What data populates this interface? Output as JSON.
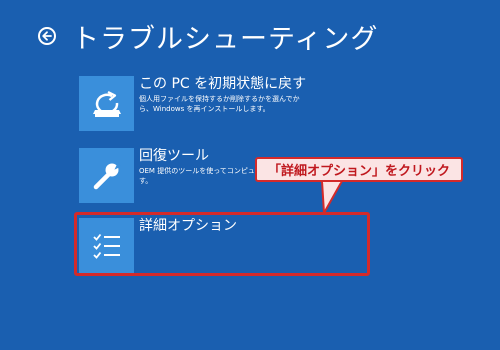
{
  "header": {
    "title": "トラブルシューティング"
  },
  "options": [
    {
      "title": "この PC を初期状態に戻す",
      "description": "個人用ファイルを保持するか削除するかを選んでから、Windows を再インストールします。",
      "icon": "reset-pc-icon"
    },
    {
      "title": "回復ツール",
      "description": "OEM 提供のツールを使ってコンピューターを修復します。",
      "icon": "wrench-icon"
    },
    {
      "title": "詳細オプション",
      "description": "",
      "icon": "checklist-icon"
    }
  ],
  "annotation": {
    "callout_text": "「詳細オプション」をクリック"
  },
  "colors": {
    "background": "#1a5fb0",
    "tile": "#3a8fdb",
    "highlight": "#d42a2a",
    "callout_bg": "#fbe4e4"
  }
}
